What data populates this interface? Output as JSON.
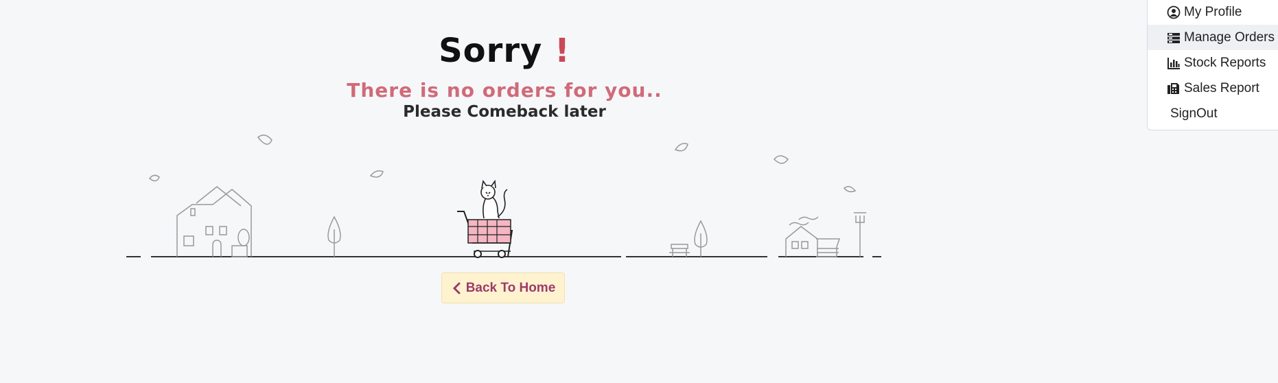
{
  "empty_state": {
    "title": "Sorry",
    "title_mark": "!",
    "message": "There is no orders for you..",
    "submessage": "Please Comeback later",
    "back_button": "Back To Home"
  },
  "dropdown_menu": {
    "items": [
      {
        "label": "My Profile",
        "icon": "user-circle-icon"
      },
      {
        "label": "Manage Orders",
        "icon": "orders-icon",
        "active": true
      },
      {
        "label": "Stock Reports",
        "icon": "bar-chart-icon"
      },
      {
        "label": "Sales Report",
        "icon": "fax-icon"
      },
      {
        "label": "SignOut"
      }
    ]
  },
  "colors": {
    "accent": "#c84a57",
    "message": "#d06b79",
    "button_bg": "#fff3cf",
    "button_text": "#9c3b6b",
    "background": "#f6f7f9"
  }
}
